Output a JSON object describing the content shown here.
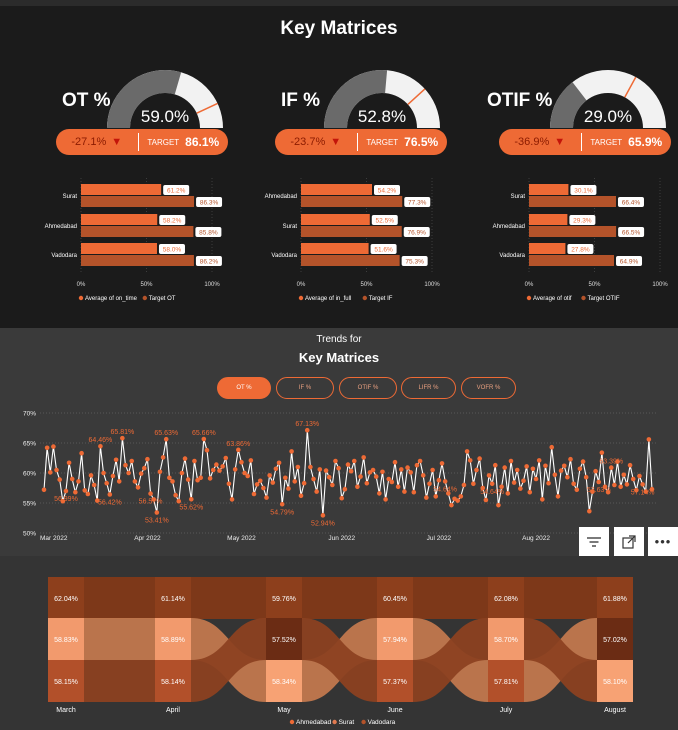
{
  "header": {
    "title": "Key Matrices"
  },
  "kpis": [
    {
      "label": "OT %",
      "value": "59.0%",
      "value_num": 59.0,
      "target_num": 86.1,
      "delta": "-27.1%",
      "target_label": "TARGET",
      "target": "86.1%"
    },
    {
      "label": "IF %",
      "value": "52.8%",
      "value_num": 52.8,
      "target_num": 76.5,
      "delta": "-23.7%",
      "target_label": "TARGET",
      "target": "76.5%"
    },
    {
      "label": "OTIF %",
      "value": "29.0%",
      "value_num": 29.0,
      "target_num": 65.9,
      "delta": "-36.9%",
      "target_label": "TARGET",
      "target": "65.9%"
    }
  ],
  "trend": {
    "subtitle": "Trends for",
    "title": "Key Matrices",
    "tabs": [
      "OT %",
      "IF %",
      "OTIF %",
      "LIFR %",
      "VOFR %"
    ],
    "active_tab": 0
  },
  "colors": {
    "accent": "#ee6a35",
    "dark_bar": "#b4532a",
    "gauge_fill": "#6a6a6a",
    "gauge_bg": "#f2f2f2"
  },
  "chart_data": [
    {
      "type": "bar",
      "orientation": "horizontal",
      "categories": [
        "Surat",
        "Ahmedabad",
        "Vadodara"
      ],
      "series": [
        {
          "name": "Average of on_time",
          "values": [
            61.2,
            58.2,
            58.0
          ],
          "labels": [
            "61.2%",
            "58.2%",
            "58.0%"
          ]
        },
        {
          "name": "Target OT",
          "values": [
            86.3,
            85.8,
            86.2
          ],
          "labels": [
            "86.3%",
            "85.8%",
            "86.2%"
          ]
        }
      ],
      "xticks": [
        "0%",
        "50%",
        "100%"
      ],
      "xlim": [
        0,
        100
      ]
    },
    {
      "type": "bar",
      "orientation": "horizontal",
      "categories": [
        "Ahmedabad",
        "Surat",
        "Vadodara"
      ],
      "series": [
        {
          "name": "Average of in_full",
          "values": [
            54.2,
            52.5,
            51.6
          ],
          "labels": [
            "54.2%",
            "52.5%",
            "51.6%"
          ]
        },
        {
          "name": "Target IF",
          "values": [
            77.3,
            76.9,
            75.3
          ],
          "labels": [
            "77.3%",
            "76.9%",
            "75.3%"
          ]
        }
      ],
      "xticks": [
        "0%",
        "50%",
        "100%"
      ],
      "xlim": [
        0,
        100
      ]
    },
    {
      "type": "bar",
      "orientation": "horizontal",
      "categories": [
        "Surat",
        "Ahmedabad",
        "Vadodara"
      ],
      "series": [
        {
          "name": "Average of otif",
          "values": [
            30.1,
            29.3,
            27.8
          ],
          "labels": [
            "30.1%",
            "29.3%",
            "27.8%"
          ]
        },
        {
          "name": "Target OTIF",
          "values": [
            66.4,
            66.5,
            64.9
          ],
          "labels": [
            "66.4%",
            "66.5%",
            "64.9%"
          ]
        }
      ],
      "xticks": [
        "0%",
        "50%",
        "100%"
      ],
      "xlim": [
        0,
        100
      ]
    },
    {
      "type": "line",
      "yticks": [
        "70%",
        "65%",
        "60%",
        "55%",
        "50%"
      ],
      "ylim": [
        50,
        70
      ],
      "xticks": [
        "Mar 2022",
        "Apr 2022",
        "May 2022",
        "Jun 2022",
        "Jul 2022",
        "Aug 2022"
      ],
      "grid": true,
      "values": [
        57.2,
        64.2,
        60.1,
        64.4,
        60.5,
        58.9,
        55.3,
        56.99,
        61.7,
        59.0,
        56.8,
        58.6,
        63.3,
        57.1,
        56.5,
        59.6,
        58.0,
        55.4,
        64.46,
        60.0,
        58.3,
        56.42,
        59.5,
        62.2,
        58.6,
        65.81,
        61.3,
        60.0,
        62.0,
        58.6,
        57.6,
        59.9,
        60.8,
        62.3,
        56.57,
        55.6,
        53.41,
        60.2,
        62.6,
        65.63,
        59.2,
        58.6,
        56.3,
        55.3,
        60.0,
        62.4,
        58.9,
        55.62,
        62.0,
        58.8,
        59.2,
        65.66,
        63.8,
        59.1,
        60.5,
        61.4,
        60.4,
        61.1,
        62.5,
        58.2,
        55.6,
        60.6,
        63.86,
        61.8,
        60.0,
        59.5,
        62.1,
        56.5,
        58.1,
        58.7,
        57.5,
        55.9,
        59.6,
        58.4,
        60.7,
        61.7,
        54.79,
        59.2,
        57.4,
        63.6,
        58.6,
        61.0,
        56.2,
        58.3,
        67.13,
        61.0,
        59.0,
        56.9,
        60.6,
        52.94,
        60.4,
        59.3,
        58.0,
        62.0,
        60.8,
        55.8,
        57.3,
        61.4,
        60.3,
        62.0,
        57.7,
        59.4,
        62.6,
        58.3,
        60.1,
        60.5,
        59.4,
        56.6,
        60.2,
        55.6,
        59.0,
        58.5,
        61.8,
        57.7,
        60.6,
        56.9,
        60.9,
        60.1,
        56.8,
        61.3,
        62.0,
        59.6,
        55.9,
        58.2,
        60.5,
        56.1,
        58.8,
        61.6,
        58.6,
        56.6,
        54.64,
        55.7,
        55.4,
        56.1,
        58.0,
        63.6,
        62.1,
        58.2,
        60.5,
        62.4,
        57.5,
        55.5,
        59.6,
        58.2,
        61.3,
        54.64,
        57.7,
        60.9,
        56.6,
        62.0,
        58.4,
        60.5,
        57.4,
        58.7,
        61.1,
        56.8,
        60.7,
        59.0,
        62.1,
        55.6,
        61.2,
        58.3,
        64.3,
        59.7,
        56.1,
        60.4,
        61.2,
        59.3,
        62.3,
        58.2,
        57.2,
        60.7,
        61.9,
        59.3,
        53.63,
        56.9,
        60.3,
        58.5,
        63.39,
        57.7,
        56.8,
        60.9,
        58.0,
        61.9,
        57.7,
        59.7,
        58.1,
        61.3,
        59.0,
        57.14,
        59.5,
        58.1,
        56.9,
        65.6,
        57.3
      ],
      "annotations": [
        {
          "text": "56.99%",
          "index": 7
        },
        {
          "text": "64.46%",
          "index": 18
        },
        {
          "text": "56.42%",
          "index": 21
        },
        {
          "text": "65.81%",
          "index": 25
        },
        {
          "text": "56.57%",
          "index": 34
        },
        {
          "text": "53.41%",
          "index": 36
        },
        {
          "text": "65.63%",
          "index": 39
        },
        {
          "text": "55.62%",
          "index": 47
        },
        {
          "text": "65.66%",
          "index": 51
        },
        {
          "text": "63.86%",
          "index": 62
        },
        {
          "text": "54.79%",
          "index": 76
        },
        {
          "text": "67.13%",
          "index": 84
        },
        {
          "text": "52.94%",
          "index": 89
        },
        {
          "text": "54.64%",
          "index": 128
        },
        {
          "text": "54.64%",
          "index": 143
        },
        {
          "text": "53.63%",
          "index": 177
        },
        {
          "text": "63.39%",
          "index": 181
        },
        {
          "text": "57.14%",
          "index": 191
        }
      ]
    },
    {
      "type": "area",
      "subtype": "ribbon",
      "categories": [
        "March",
        "April",
        "May",
        "June",
        "July",
        "August"
      ],
      "series": [
        {
          "name": "Ahmedabad",
          "values": [
            62.04,
            61.14,
            59.76,
            60.45,
            62.08,
            61.88
          ],
          "labels": [
            "62.04%",
            "61.14%",
            "59.76%",
            "60.45%",
            "62.08%",
            "61.88%"
          ]
        },
        {
          "name": "Surat",
          "values": [
            58.83,
            58.89,
            58.34,
            57.94,
            58.7,
            58.1
          ],
          "labels": [
            "58.83%",
            "58.89%",
            "58.34%",
            "57.94%",
            "58.70%",
            "58.10%"
          ]
        },
        {
          "name": "Vadodara",
          "values": [
            58.15,
            58.14,
            57.52,
            57.37,
            57.81,
            57.02
          ],
          "labels": [
            "58.15%",
            "58.14%",
            "57.52%",
            "57.37%",
            "57.81%",
            "57.02%"
          ]
        }
      ],
      "legend": "bottom"
    }
  ]
}
